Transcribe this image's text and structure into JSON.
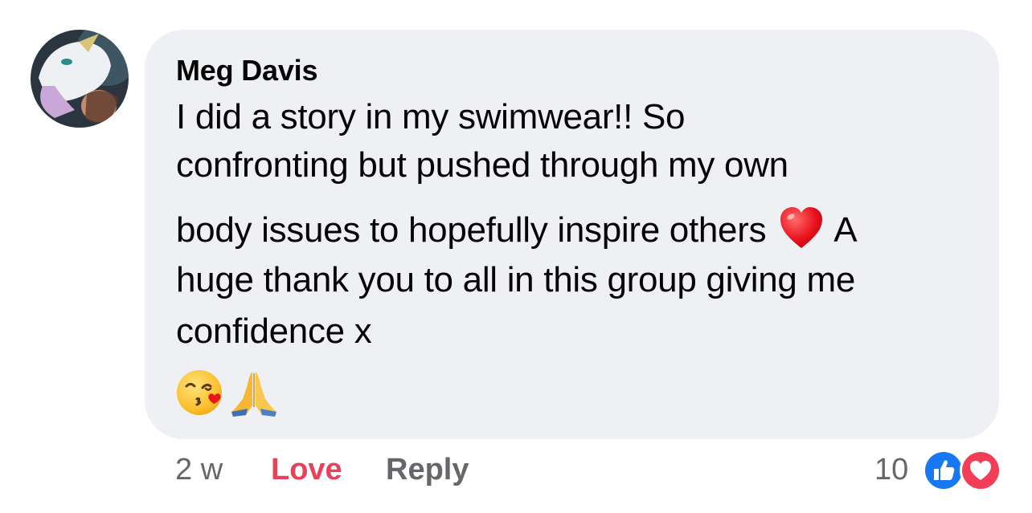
{
  "comment": {
    "author": "Meg Davis",
    "lines": [
      "I did a story in my swimwear!! So",
      "confronting but pushed through my own",
      "body issues to hopefully inspire others",
      "A",
      "huge thank you to all in this group giving me",
      "confidence x"
    ],
    "inline_emoji": "red-heart",
    "trailing_emojis": [
      "face-blowing-a-kiss",
      "folded-hands"
    ]
  },
  "footer": {
    "timestamp": "2 w",
    "love_label": "Love",
    "reply_label": "Reply",
    "reaction_count": "10",
    "reaction_icons": [
      "thumbs-up-icon",
      "heart-icon"
    ]
  },
  "colors": {
    "bubble": "#eff0f4",
    "text": "#050505",
    "secondary": "#65676b",
    "love": "#e6425a",
    "like_blue": "#1877f2",
    "heart_red": "#f33e58"
  }
}
